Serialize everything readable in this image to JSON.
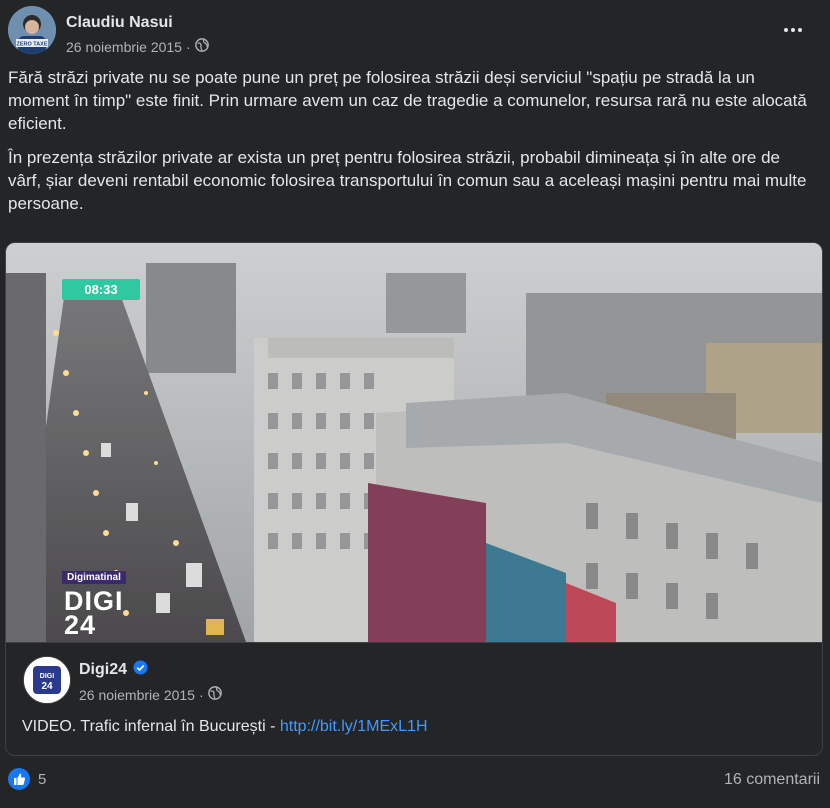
{
  "post": {
    "author": "Claudiu Nasui",
    "date": "26 noiembrie 2015",
    "avatar_caption": "ZERO TAXE",
    "paragraphs": [
      "Fără străzi private nu se poate pune un preț pe folosirea străzii deși serviciul \"spațiu pe stradă la un moment în timp\" este finit. Prin urmare avem un caz de tragedie a comunelor, resursa rară nu este alocată eficient.",
      "În prezența străzilor private ar exista un preț pentru folosirea străzii, probabil dimineața și în alte ore de vârf, șiar deveni rentabil economic folosirea transportului în comun sau a aceleași mașini pentru mai multe persoane."
    ]
  },
  "shared": {
    "video": {
      "time": "08:33",
      "brand_tag": "Digimatinal",
      "brand_logo_line1": "DIGI",
      "brand_logo_line2": "24"
    },
    "page_name": "Digi24",
    "page_date": "26 noiembrie 2015",
    "share_text": "VIDEO. Trafic infernal în București - ",
    "share_link": "http://bit.ly/1MExL1H",
    "page_logo_text": "DIGI",
    "page_logo_num": "24"
  },
  "footer": {
    "likes": "5",
    "comments": "16 comentarii"
  },
  "icons": {
    "audience": "globe-icon",
    "verified": "verified-badge-icon",
    "reaction": "like-icon",
    "menu": "more-options-icon"
  },
  "colors": {
    "background": "#242526",
    "text": "#e4e6eb",
    "muted": "#b0b3b8",
    "link": "#4599ff",
    "like": "#1877f2",
    "time_badge": "#2fc9a1"
  }
}
